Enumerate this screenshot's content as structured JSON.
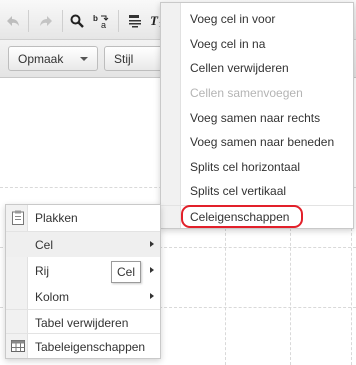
{
  "toolbar": {
    "row1_icons": [
      "undo-icon",
      "redo-icon",
      "find-icon",
      "find-replace-icon",
      "paste-as-text-icon",
      "clear-formatting-icon"
    ],
    "format_label": "Opmaak",
    "style_label": "Stijl"
  },
  "cell_submenu": {
    "items": [
      {
        "label": "Voeg cel in voor",
        "disabled": false
      },
      {
        "label": "Voeg cel in na",
        "disabled": false
      },
      {
        "label": "Cellen verwijderen",
        "disabled": false
      },
      {
        "label": "Cellen samenvoegen",
        "disabled": true
      },
      {
        "label": "Voeg samen naar rechts",
        "disabled": false
      },
      {
        "label": "Voeg samen naar beneden",
        "disabled": false
      },
      {
        "label": "Splits cel horizontaal",
        "disabled": false
      },
      {
        "label": "Splits cel vertikaal",
        "disabled": false
      },
      {
        "label": "Celeigenschappen",
        "disabled": false,
        "highlighted": true
      }
    ]
  },
  "context_menu": {
    "paste": "Plakken",
    "cell": "Cel",
    "row": "Rij",
    "column": "Kolom",
    "delete_table": "Tabel verwijderen",
    "table_properties": "Tabeleigenschappen"
  },
  "tooltip": "Cel",
  "colors": {
    "highlight": "#e2202a",
    "disabled_text": "#b4b4b4"
  }
}
